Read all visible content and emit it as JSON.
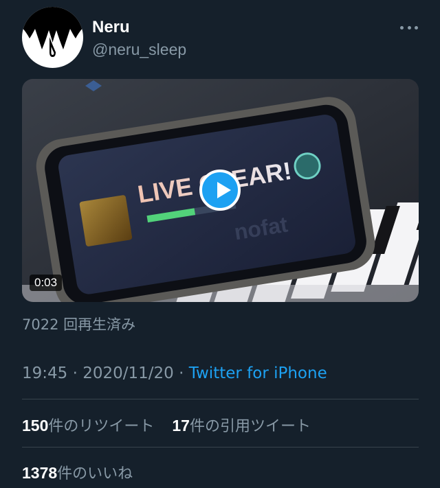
{
  "user": {
    "name": "Neru",
    "handle": "@neru_sleep"
  },
  "media": {
    "duration": "0:03",
    "screen_text": "LIVE CLEAR!"
  },
  "views": "7022 回再生済み",
  "meta": {
    "time": "19:45",
    "date": "2020/11/20",
    "source": "Twitter for iPhone"
  },
  "stats": {
    "retweets_count": "150",
    "retweets_label": "件のリツイート",
    "quotes_count": "17",
    "quotes_label": "件の引用ツイート",
    "likes_count": "1378",
    "likes_label": "件のいいね"
  },
  "colors": {
    "background": "#15202b",
    "accent": "#1da1f2",
    "secondary_text": "#8899a6",
    "divider": "#38444d"
  },
  "icons": {
    "more": "more-icon",
    "play": "play-icon"
  }
}
